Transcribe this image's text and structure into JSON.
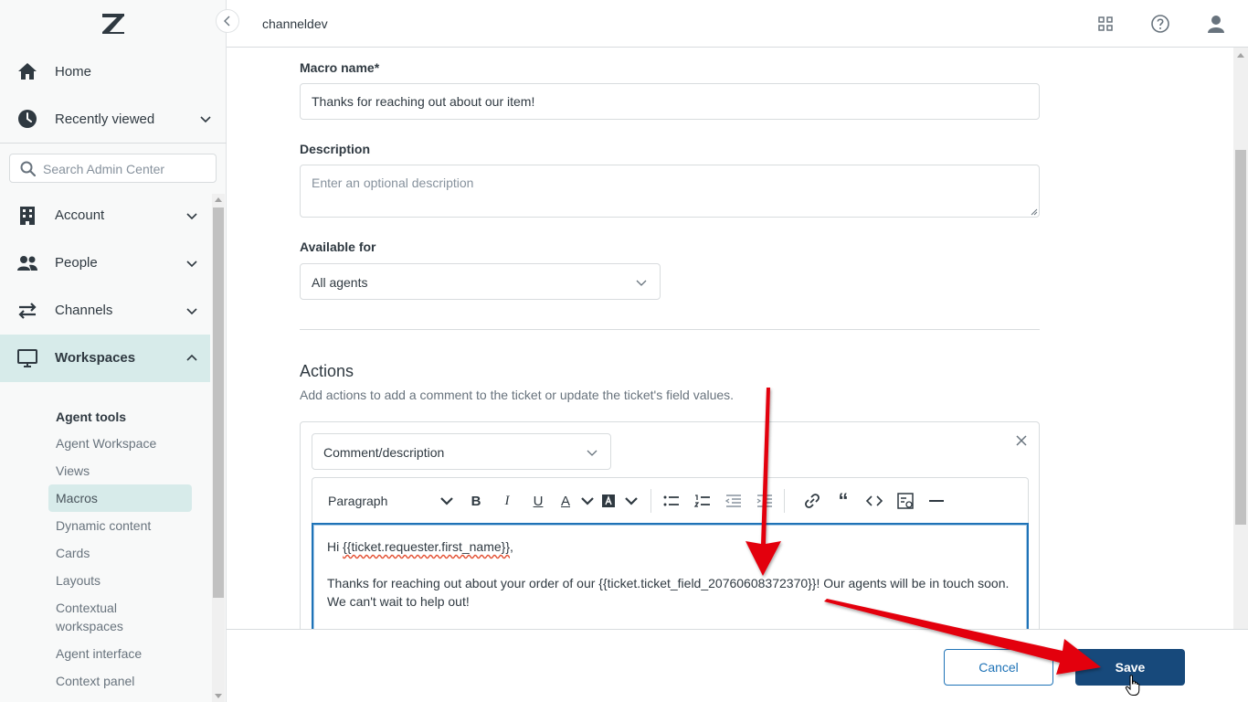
{
  "sidebar": {
    "home_label": "Home",
    "recent_label": "Recently viewed",
    "search_placeholder": "Search Admin Center",
    "sections": [
      {
        "label": "Account"
      },
      {
        "label": "People"
      },
      {
        "label": "Channels"
      },
      {
        "label": "Workspaces"
      }
    ],
    "sub_heading": "Agent tools",
    "sub_items": [
      {
        "label": "Agent Workspace"
      },
      {
        "label": "Views"
      },
      {
        "label": "Macros"
      },
      {
        "label": "Dynamic content"
      },
      {
        "label": "Cards"
      },
      {
        "label": "Layouts"
      },
      {
        "label": "Contextual workspaces"
      },
      {
        "label": "Agent interface"
      },
      {
        "label": "Context panel"
      }
    ]
  },
  "header": {
    "title": "channeldev"
  },
  "form": {
    "macro_name_label": "Macro name*",
    "macro_name_value": "Thanks for reaching out about our item!",
    "description_label": "Description",
    "description_placeholder": "Enter an optional description",
    "available_label": "Available for",
    "available_value": "All agents",
    "actions_heading": "Actions",
    "actions_subtext": "Add actions to add a comment to the ticket or update the ticket's field values.",
    "action_type": "Comment/description",
    "toolbar_paragraph": "Paragraph",
    "editor": {
      "line1_prefix": "Hi ",
      "line1_placeholder": "{{ticket.requester.first_name}}",
      "line1_suffix": ",",
      "line2_text": "Thanks for reaching out about your order of our {{ticket.ticket_field_20760608372370}}! Our agents will be in touch soon.",
      "line3_text": "We can't wait to help out!"
    }
  },
  "footer": {
    "cancel_label": "Cancel",
    "save_label": "Save"
  },
  "colors": {
    "accent_blue": "#1f73b7",
    "save_button": "#17497b",
    "active_nav": "#d7ebea",
    "annotation_arrow": "#e3000f"
  },
  "icons": [
    "zendesk-logo",
    "home-icon",
    "clock-icon",
    "search-icon",
    "building-icon",
    "people-icon",
    "arrows-icon",
    "monitor-icon",
    "grid-icon",
    "help-icon",
    "user-icon",
    "close-icon",
    "chevron-down-icon"
  ]
}
